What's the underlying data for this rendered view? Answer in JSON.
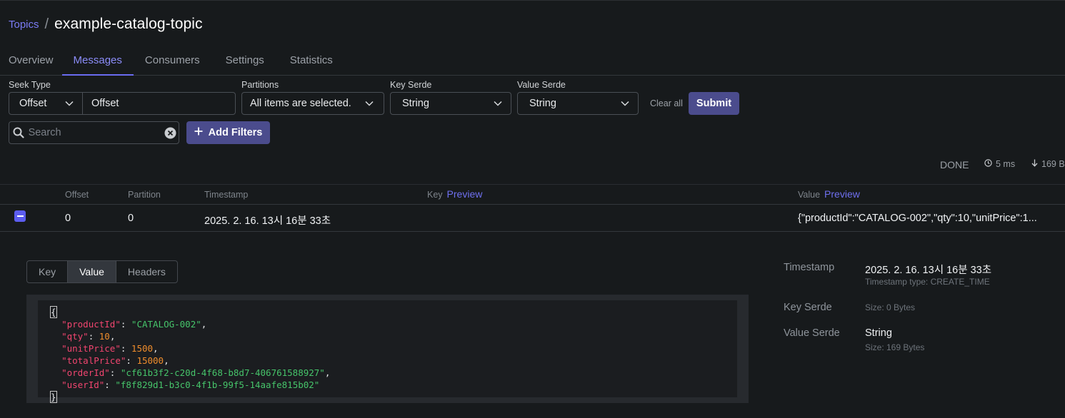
{
  "breadcrumb": {
    "parent": "Topics",
    "separator": "/",
    "title": "example-catalog-topic"
  },
  "tabs": [
    {
      "label": "Overview"
    },
    {
      "label": "Messages"
    },
    {
      "label": "Consumers"
    },
    {
      "label": "Settings"
    },
    {
      "label": "Statistics"
    }
  ],
  "filters": {
    "seek_type_label": "Seek Type",
    "seek_type_value": "Offset",
    "seek_input_value": "Offset",
    "partitions_label": "Partitions",
    "partitions_value": "All items are selected.",
    "key_serde_label": "Key Serde",
    "key_serde_value": "String",
    "value_serde_label": "Value Serde",
    "value_serde_value": "String",
    "clear_all": "Clear all",
    "submit": "Submit",
    "search_placeholder": "Search",
    "add_filters": "Add Filters"
  },
  "status": {
    "state": "DONE",
    "elapsed": "5 ms",
    "size": "169 B"
  },
  "table": {
    "headers": {
      "offset": "Offset",
      "partition": "Partition",
      "timestamp": "Timestamp",
      "key": "Key",
      "key_preview": "Preview",
      "value": "Value",
      "value_preview": "Preview"
    },
    "row": {
      "offset": "0",
      "partition": "0",
      "timestamp": "2025. 2. 16. 13시 16분 33초",
      "key": "",
      "value": "{\"productId\":\"CATALOG-002\",\"qty\":10,\"unitPrice\":1..."
    }
  },
  "detail": {
    "tabs": [
      "Key",
      "Value",
      "Headers"
    ],
    "active_tab": "Value",
    "json": {
      "open": "{",
      "close": "}",
      "lines": [
        {
          "key": "\"productId\"",
          "value": "\"CATALOG-002\"",
          "type": "string"
        },
        {
          "key": "\"qty\"",
          "value": "10",
          "type": "number"
        },
        {
          "key": "\"unitPrice\"",
          "value": "1500",
          "type": "number"
        },
        {
          "key": "\"totalPrice\"",
          "value": "15000",
          "type": "number"
        },
        {
          "key": "\"orderId\"",
          "value": "\"cf61b3f2-c20d-4f68-b8d7-406761588927\"",
          "type": "string"
        },
        {
          "key": "\"userId\"",
          "value": "\"f8f829d1-b3c0-4f1b-99f5-14aafe815b02\"",
          "type": "string"
        }
      ]
    },
    "meta": {
      "timestamp_label": "Timestamp",
      "timestamp_value": "2025. 2. 16. 13시 16분 33초",
      "timestamp_type": "Timestamp type: CREATE_TIME",
      "key_serde_label": "Key Serde",
      "key_serde_size": "Size: 0 Bytes",
      "value_serde_label": "Value Serde",
      "value_serde_value": "String",
      "value_serde_size": "Size: 169 Bytes"
    }
  },
  "colors": {
    "accent": "#6a6cf0",
    "button": "#4b4c8d",
    "background": "#171a1c",
    "json_key": "#f1456f",
    "json_string": "#46c46a",
    "json_number": "#f08d2c"
  }
}
